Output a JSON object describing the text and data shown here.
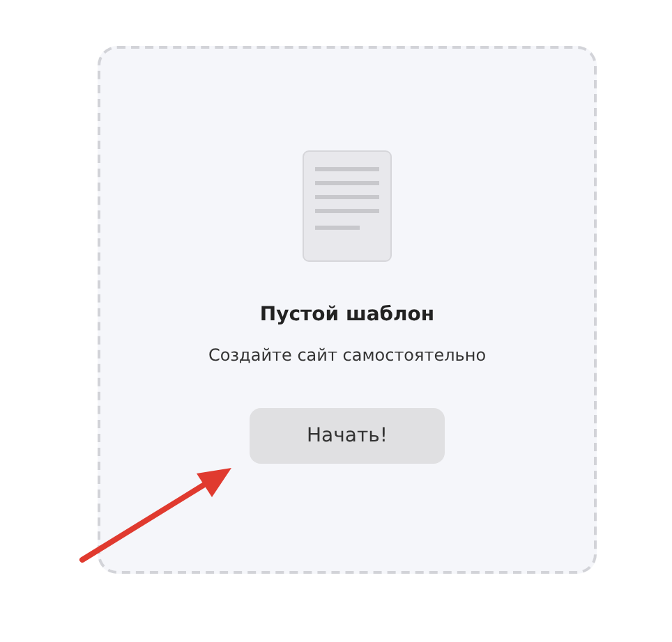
{
  "template": {
    "title": "Пустой шаблон",
    "description": "Создайте сайт самостоятельно",
    "button": "Начать!"
  }
}
